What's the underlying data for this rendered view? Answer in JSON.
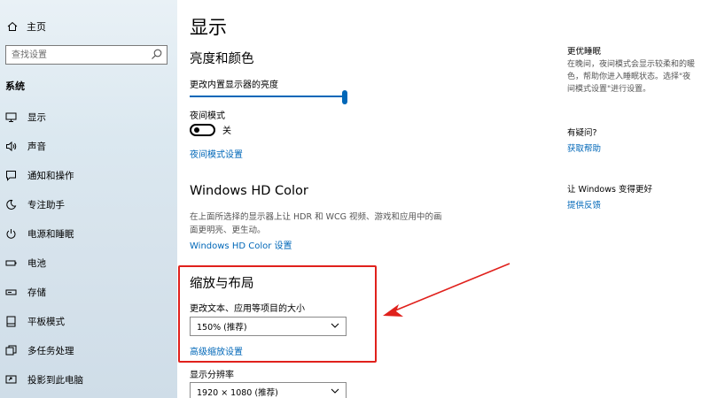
{
  "sidebar": {
    "home_label": "主页",
    "search_placeholder": "查找设置",
    "section_label": "系统",
    "items": [
      {
        "label": "显示",
        "icon": "monitor-icon"
      },
      {
        "label": "声音",
        "icon": "speaker-icon"
      },
      {
        "label": "通知和操作",
        "icon": "notification-icon"
      },
      {
        "label": "专注助手",
        "icon": "moon-icon"
      },
      {
        "label": "电源和睡眠",
        "icon": "power-icon"
      },
      {
        "label": "电池",
        "icon": "battery-icon"
      },
      {
        "label": "存储",
        "icon": "storage-icon"
      },
      {
        "label": "平板模式",
        "icon": "tablet-icon"
      },
      {
        "label": "多任务处理",
        "icon": "multitask-icon"
      },
      {
        "label": "投影到此电脑",
        "icon": "project-icon"
      }
    ]
  },
  "main": {
    "title": "显示",
    "brightness_heading": "亮度和颜色",
    "brightness_label": "更改内置显示器的亮度",
    "brightness_level": 1.0,
    "night_mode_label": "夜间模式",
    "night_mode_state": "关",
    "night_mode_link": "夜间模式设置",
    "hdr_heading": "Windows HD Color",
    "hdr_desc": "在上面所选择的显示器上让 HDR 和 WCG 视频、游戏和应用中的画面更明亮、更生动。",
    "hdr_link": "Windows HD Color 设置",
    "scale_heading": "缩放与布局",
    "scale_label": "更改文本、应用等项目的大小",
    "scale_value": "150% (推荐)",
    "scale_link": "高级缩放设置",
    "resolution_label": "显示分辨率",
    "resolution_value": "1920 × 1080 (推荐)"
  },
  "right_panel": {
    "sleep_title": "更优睡眠",
    "sleep_desc": "在晚间，夜间模式会显示较柔和的暖色，帮助你进入睡眠状态。选择\"夜间模式设置\"进行设置。",
    "help_title": "有疑问?",
    "help_link": "获取帮助",
    "improve_title": "让 Windows 变得更好",
    "feedback_link": "提供反馈"
  },
  "colors": {
    "accent": "#0067b8",
    "annotation": "#e0211c"
  }
}
